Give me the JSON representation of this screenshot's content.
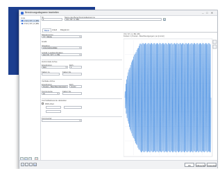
{
  "window": {
    "title": "Berechnungsdiagramm bearbeiten",
    "minimize": "–",
    "maximize": "□",
    "close": "✕"
  },
  "left_panel": {
    "header": "Liste",
    "items": [
      {
        "label": "1  VO | ST | 1 | BS"
      },
      {
        "label": "2  VO | ST | 2 | BS"
      }
    ]
  },
  "top_fields": {
    "no_label": "Nr.",
    "no_value": "1",
    "name_label": "Name des Berechnungsdiagramms",
    "name_value": "VO | ST | 1 | BS"
  },
  "tabs": [
    "Basis",
    "Anteil",
    "Diagramm"
  ],
  "form": {
    "diagram_type_label": "Diagrammtyp",
    "diagram_type_value": "XY | Werte",
    "grafik_label": "Grafik",
    "objekt_label": "Objekttyp",
    "objekt_value": "Lösungsresultate",
    "punkt_label": "Lösfall / Lastkombination",
    "punkt_value": "Zeit VO | ST | 1 | BS",
    "horizontal_hdr": "Horizontale Achse",
    "ergebnis_label": "Ergebnistyp",
    "ergebnis_value": "Zeit",
    "einheit_label": "Einh.",
    "einheit_value": "s",
    "faktor_label": "Faktor zu",
    "faktor2_label": "Faktor bis",
    "vertikal_hdr": "Vertikale Achse",
    "vertical_value": "Knoten - Beschleunigungen",
    "vertical_unit": "mm/s²",
    "komponente_label": "Komponente",
    "komponente_value": "ax",
    "max_label": "Maximale Gesamtwert",
    "rms_label": "Auch Effektivwerte darstellen",
    "rms_sub": "RMS-Wert",
    "kommentar_label": "Kommentar"
  },
  "chart_header": {
    "line1": "VO | ST | 1 | BS | BS",
    "line2": "Knoten 1 | Knoten - Beschleunigungen | ax [mm/s²]"
  },
  "chart_data": {
    "type": "line",
    "description_series": "dense oscillating response, amplitude grows then stays constant",
    "x_range": [
      0,
      10
    ],
    "y_range": [
      -1,
      1
    ],
    "envelope_ramp_end_fraction": 0.18,
    "cycles": 110,
    "color": "#4a90e2",
    "grid": true
  },
  "bottom": {
    "ok": "OK",
    "cancel": "Abbrechen",
    "apply": "Anwenden"
  },
  "colors": {
    "accent": "#3a6fd8",
    "selection": "#cfe0f7",
    "background_panel": "#1c3f8f"
  }
}
